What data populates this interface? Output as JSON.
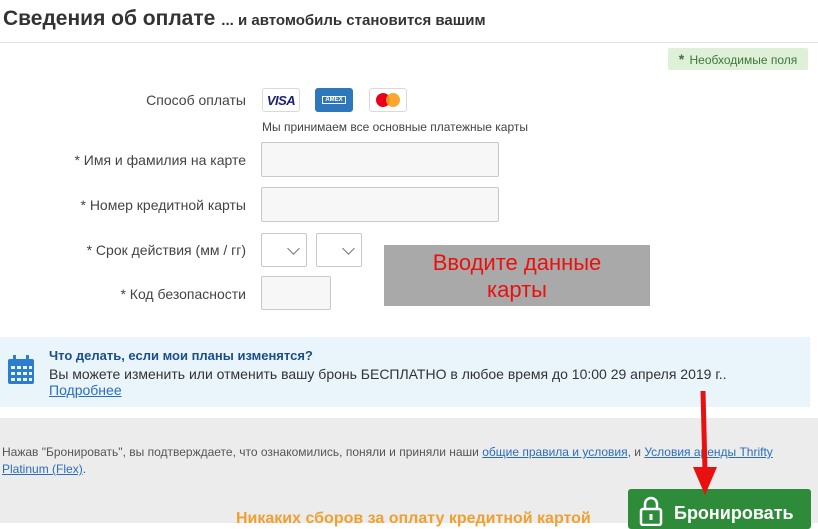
{
  "header": {
    "title": "Сведения об оплате",
    "subtitle": "... и автомобиль становится вашим"
  },
  "required_note": {
    "star": "*",
    "text": "Необходимые поля"
  },
  "payment": {
    "method_label": "Способ оплаты",
    "cards": [
      "VISA",
      "AMEX",
      "mastercard"
    ],
    "visa_text": "VISA",
    "amex_text": "AMEX",
    "accept_note": "Мы принимаем все основные платежные карты"
  },
  "fields": {
    "name_label": "* Имя и фамилия на карте",
    "name_value": "",
    "card_number_label": "* Номер кредитной карты",
    "card_number_value": "",
    "expiry_label": "* Срок действия (мм / гг)",
    "expiry_month_value": "",
    "expiry_year_value": "",
    "cvv_label": "* Код безопасности",
    "cvv_value": ""
  },
  "overlay": {
    "line1": "Вводите данные",
    "line2": "карты",
    "color": "#e8110f"
  },
  "info": {
    "icon": "calendar-icon",
    "title": "Что делать, если мои планы изменятся?",
    "text": "Вы можете изменить или отменить вашу бронь БЕСПЛАТНО в любое время до 10:00 29 апреля 2019 г..",
    "link": "Подробнее"
  },
  "footer": {
    "legal_prefix": "Нажав \"Бронировать\", вы подтверждаете, что ознакомились, поняли и приняли наши ",
    "legal_link1": "общие правила и условия",
    "legal_middle": ", и ",
    "legal_link2": "Условия аренды Thrifty Platinum (Flex)",
    "legal_suffix": ".",
    "no_fees": "Никаких сборов за оплату кредитной картой"
  },
  "book_button": {
    "label": "Бронировать",
    "icon": "lock-icon",
    "color": "#2e8b3a"
  },
  "annotation_arrow": {
    "color": "#e8110f"
  }
}
